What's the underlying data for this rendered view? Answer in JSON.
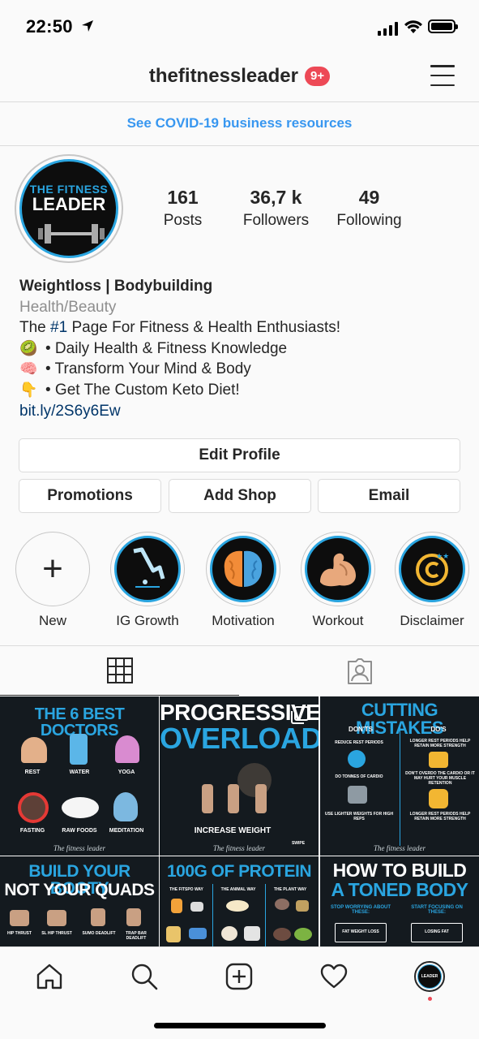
{
  "status_bar": {
    "time": "22:50"
  },
  "header": {
    "username": "thefitnessleader",
    "notification_badge": "9+"
  },
  "banner": {
    "text": "See COVID-19 business resources"
  },
  "profile": {
    "avatar_text_top": "THE FITNESS",
    "avatar_text_bottom": "LEADER",
    "stats": [
      {
        "value": "161",
        "label": "Posts"
      },
      {
        "value": "36,7 k",
        "label": "Followers"
      },
      {
        "value": "49",
        "label": "Following"
      }
    ],
    "bio": {
      "name": "Weightloss | Bodybuilding",
      "category": "Health/Beauty",
      "line1_prefix": "The ",
      "line1_hashtag": "#1",
      "line1_suffix": " Page For Fitness & Health Enthusiasts!",
      "line2_emoji": "🥝",
      "line2": "• Daily Health & Fitness Knowledge",
      "line3_emoji": "🧠",
      "line3": "• Transform Your Mind & Body",
      "line4_emoji": "👇",
      "line4": "• Get The Custom Keto Diet!",
      "link": "bit.ly/2S6y6Ew"
    }
  },
  "buttons": {
    "edit_profile": "Edit Profile",
    "promotions": "Promotions",
    "add_shop": "Add Shop",
    "email": "Email"
  },
  "highlights": [
    {
      "label": "New",
      "icon": "plus-icon"
    },
    {
      "label": "IG Growth",
      "icon": "graph-icon"
    },
    {
      "label": "Motivation",
      "icon": "brain-icon"
    },
    {
      "label": "Workout",
      "icon": "bicep-icon"
    },
    {
      "label": "Disclaimer",
      "icon": "copyright-icon"
    }
  ],
  "tabs": [
    {
      "name": "grid",
      "icon": "grid-icon"
    },
    {
      "name": "tagged",
      "icon": "tagged-person-icon"
    }
  ],
  "posts": [
    {
      "title": "THE 6 BEST DOCTORS",
      "labels": [
        "REST",
        "WATER",
        "YOGA",
        "FASTING",
        "RAW FOODS",
        "MEDITATION"
      ],
      "signature": "The fitness leader"
    },
    {
      "title_line1": "PROGRESSIVE",
      "title_line2": "OVERLOAD",
      "caption": "INCREASE WEIGHT",
      "swipe": "SWIPE",
      "signature": "The fitness leader"
    },
    {
      "title": "CUTTING MISTAKES",
      "col1": "DON'TS",
      "col2": "DO'S",
      "left": [
        "REDUCE REST PERIODS",
        "DO TONNES OF CARDIO",
        "USE LIGHTER WEIGHTS FOR HIGH REPS"
      ],
      "right": [
        "LONGER REST PERIODS HELP RETAIN MORE STRENGTH",
        "DON'T OVERDO THE CARDIO OR IT MAY HURT YOUR MUSCLE RETENTION",
        "LONGER REST PERIODS HELP RETAIN MORE STRENGTH"
      ],
      "signature": "The fitness leader"
    },
    {
      "title_line1": "BUILD YOUR BOOTY",
      "title_line2": "NOT YOUR QUADS",
      "labels": [
        "HIP THRUST",
        "SL HIP THRUST",
        "SUMO DEADLIFT",
        "TRAP BAR DEADLIFT"
      ]
    },
    {
      "title": "100G OF PROTEIN",
      "cols": [
        "THE FITSPO WAY",
        "THE ANIMAL WAY",
        "THE PLANT WAY"
      ]
    },
    {
      "title_line1": "HOW TO BUILD",
      "title_line2": "A TONED BODY",
      "left": "STOP WORRYING ABOUT THESE:",
      "right": "START FOCUSING ON THESE:",
      "left_item": "FAT WEIGHT LOSS",
      "right_item": "LOSING FAT"
    }
  ],
  "bottom_nav": [
    {
      "name": "home",
      "icon": "home-icon"
    },
    {
      "name": "search",
      "icon": "search-icon"
    },
    {
      "name": "new-post",
      "icon": "add-post-icon"
    },
    {
      "name": "activity",
      "icon": "heart-icon"
    },
    {
      "name": "profile",
      "icon": "profile-avatar-icon",
      "avatar_text": "LEADER"
    }
  ],
  "colors": {
    "accent_blue": "#3897f0",
    "brand_blue": "#2aa5e0",
    "badge_red": "#ed4956",
    "link_dark": "#003569"
  }
}
